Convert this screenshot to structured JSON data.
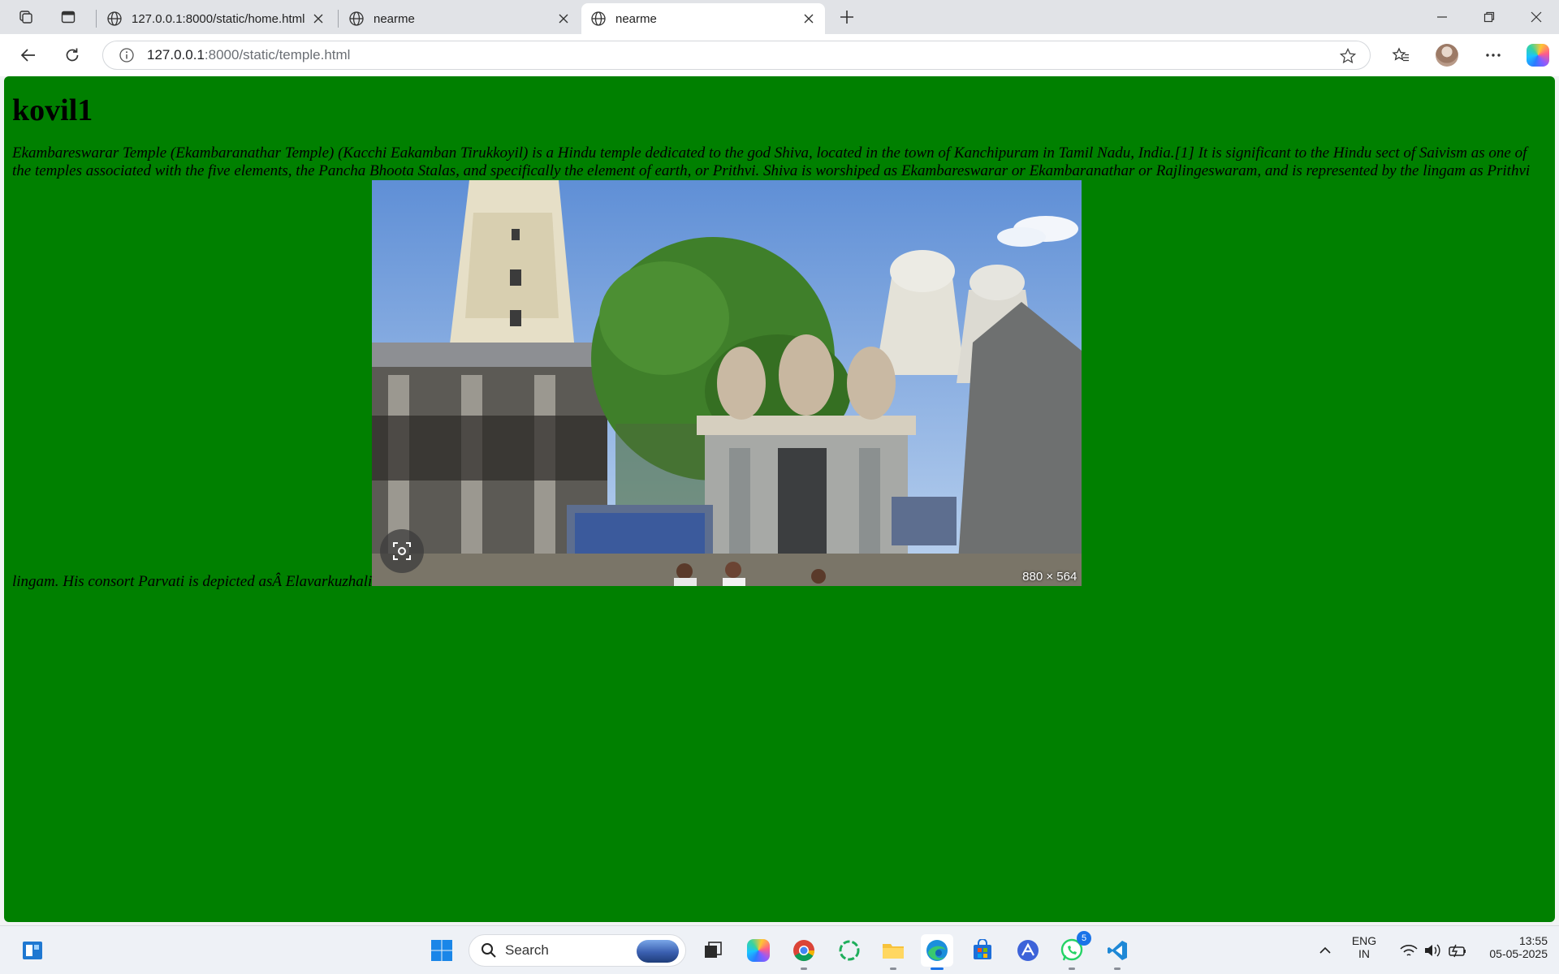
{
  "browser": {
    "tabs": [
      {
        "title": "127.0.0.1:8000/static/home.html"
      },
      {
        "title": "nearme"
      },
      {
        "title": "nearme"
      }
    ],
    "address": {
      "host": "127.0.0.1",
      "path": ":8000/static/temple.html"
    }
  },
  "page": {
    "heading": "kovil1",
    "paragraph_before_image": "Ekambareswarar Temple (Ekambaranathar Temple) (Kacchi Eakamban Tirukkoyil) is a Hindu temple dedicated to the god Shiva, located in the town of Kanchipuram in Tamil Nadu, India.[1] It is significant to the Hindu sect of Saivism as one of the temples associated with the five elements, the Pancha Bhoota Stalas, and specifically the element of earth, or Prithvi. Shiva is worshiped as Ekambareswarar or Ekambaranathar or Rajlingeswaram, and is represented by the lingam as Prithvi lingam. His consort Parvati is depicted asÂ Elavarkuzhali",
    "image": {
      "alt": "Ekambareswarar temple gopuram and shrine",
      "dimension_label": "880 × 564",
      "colors": {
        "sky": "#8fb6e8",
        "gopuram": "#e9e2cc",
        "tree": "#3f7f2a",
        "stone": "#7b7e80"
      }
    },
    "background_color": "#008000"
  },
  "taskbar": {
    "search_label": "Search",
    "whatsapp_badge": "5",
    "language_top": "ENG",
    "language_bottom": "IN",
    "time": "13:55",
    "date": "05-05-2025"
  }
}
